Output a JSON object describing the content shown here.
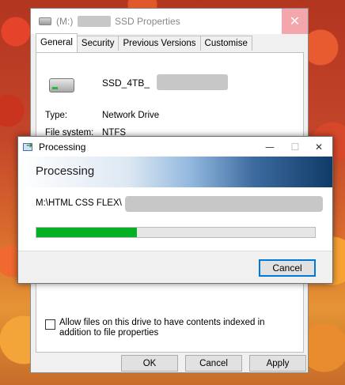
{
  "properties": {
    "title_prefix": "(M:)",
    "title_suffix": "SSD Properties",
    "close_glyph": "✕",
    "tabs": [
      {
        "label": "General",
        "active": true
      },
      {
        "label": "Security",
        "active": false
      },
      {
        "label": "Previous Versions",
        "active": false
      },
      {
        "label": "Customise",
        "active": false
      }
    ],
    "drive_name": "SSD_4TB_",
    "type_label": "Type:",
    "type_value": "Network Drive",
    "fs_label": "File system:",
    "fs_value": "NTFS",
    "index_checkbox": {
      "checked": false,
      "label": "Allow files on this drive to have contents indexed in addition to file properties"
    },
    "buttons": {
      "ok": "OK",
      "cancel": "Cancel",
      "apply": "Apply"
    }
  },
  "processing": {
    "title": "Processing",
    "minimize_glyph": "—",
    "maximize_glyph": "☐",
    "close_glyph": "✕",
    "banner": "Processing",
    "path": "M:\\HTML CSS FLEX\\",
    "progress": 0.36,
    "progress_color": "#06b025",
    "cancel": "Cancel"
  },
  "icons": {
    "drive": "drive-icon",
    "processing": "processing-icon"
  }
}
